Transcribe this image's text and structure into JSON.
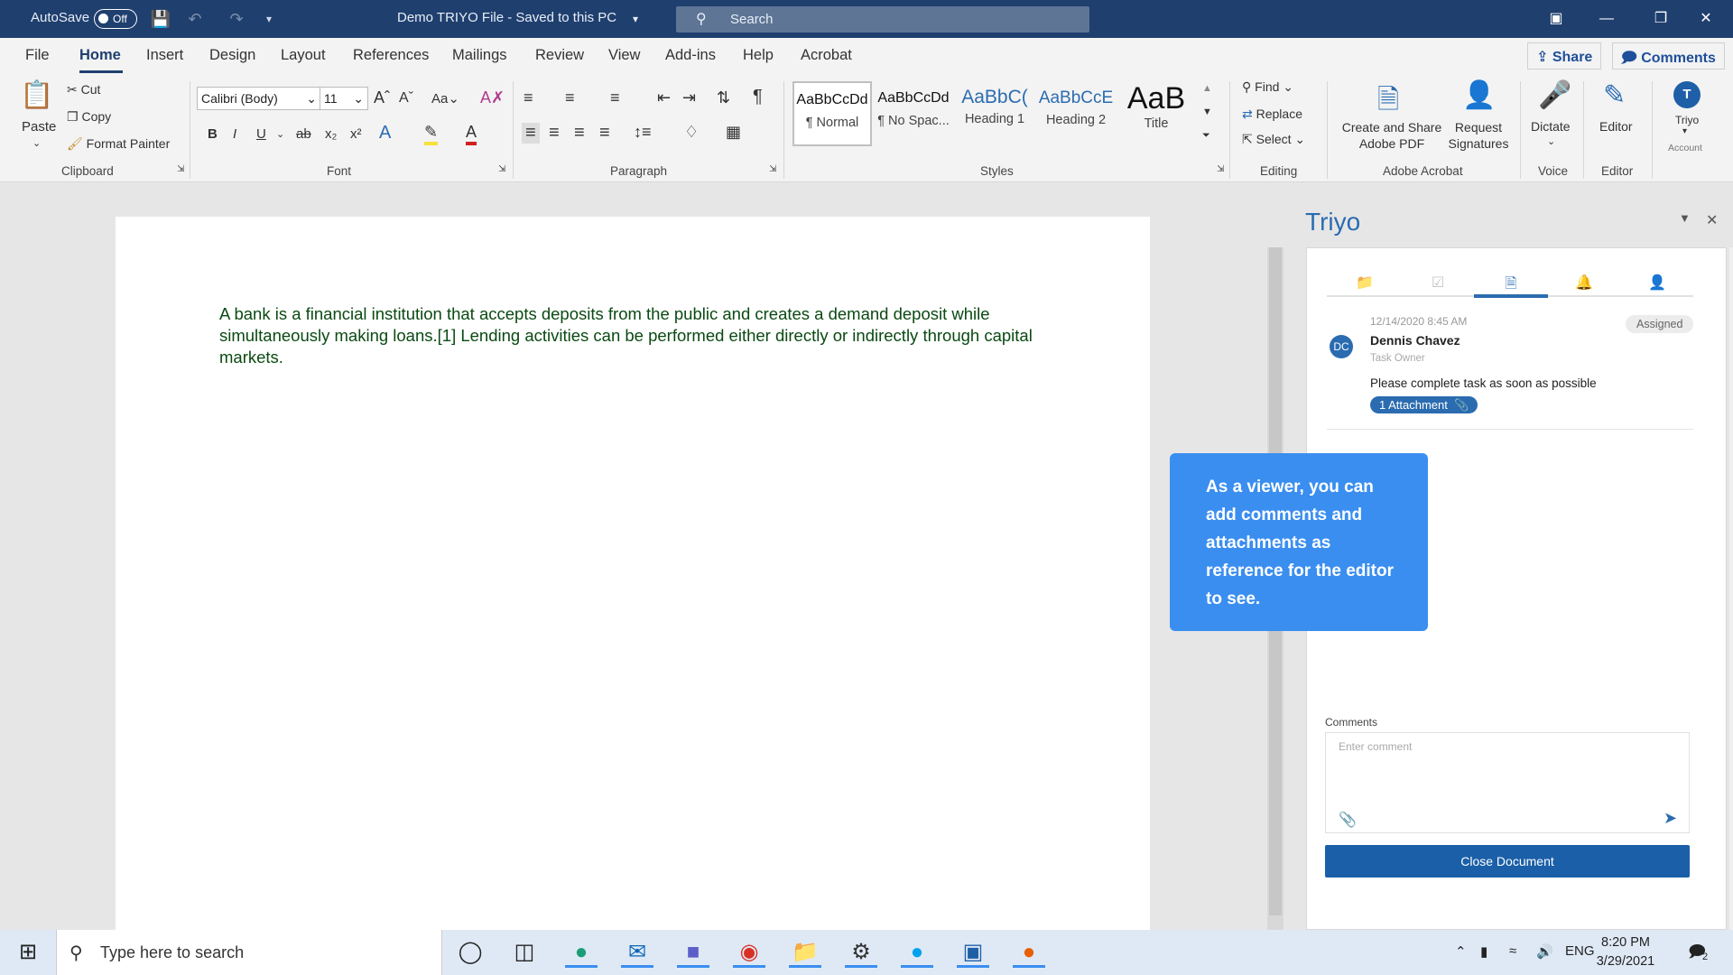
{
  "titlebar": {
    "autosave_label": "AutoSave",
    "autosave_state": "Off",
    "doc_title": "Demo TRIYO File  -  Saved to this PC",
    "search_placeholder": "Search"
  },
  "menu": {
    "tabs": [
      "File",
      "Home",
      "Insert",
      "Design",
      "Layout",
      "References",
      "Mailings",
      "Review",
      "View",
      "Add-ins",
      "Help",
      "Acrobat"
    ],
    "active_tab": "Home",
    "share": "Share",
    "comments": "Comments"
  },
  "ribbon": {
    "clipboard": {
      "paste": "Paste",
      "cut": "Cut",
      "copy": "Copy",
      "format_painter": "Format Painter",
      "label": "Clipboard"
    },
    "font": {
      "family": "Calibri (Body)",
      "size": "11",
      "label": "Font"
    },
    "paragraph": {
      "label": "Paragraph"
    },
    "styles": {
      "items": [
        {
          "preview": "AaBbCcDd",
          "name": "¶ Normal"
        },
        {
          "preview": "AaBbCcDd",
          "name": "¶ No Spac..."
        },
        {
          "preview": "AaBbC(",
          "name": "Heading 1"
        },
        {
          "preview": "AaBbCcE",
          "name": "Heading 2"
        },
        {
          "preview": "AaB",
          "name": "Title"
        }
      ],
      "label": "Styles"
    },
    "editing": {
      "find": "Find",
      "replace": "Replace",
      "select": "Select",
      "label": "Editing"
    },
    "acrobat": {
      "create": "Create and Share",
      "create2": "Adobe PDF",
      "request": "Request",
      "request2": "Signatures",
      "label": "Adobe Acrobat"
    },
    "voice": {
      "dictate": "Dictate",
      "label": "Voice"
    },
    "editor": {
      "editor": "Editor",
      "label": "Editor"
    },
    "account": {
      "triyo": "Triyo",
      "label": "Account",
      "initial": "T"
    }
  },
  "document": {
    "body": "A bank is a financial institution that accepts deposits from the public and creates a demand deposit while simultaneously making loans.[1] Lending activities can be performed either directly or indirectly through capital markets."
  },
  "pane": {
    "title": "Triyo",
    "timestamp": "12/14/2020  8:45 AM",
    "status": "Assigned",
    "avatar": "DC",
    "owner": "Dennis Chavez",
    "role": "Task Owner",
    "message": "Please complete task as soon as possible",
    "attachment": "1 Attachment",
    "comments_label": "Comments",
    "comment_placeholder": "Enter comment",
    "close_button": "Close Document"
  },
  "tooltip": {
    "text": "As a viewer, you can add comments and attachments as reference for the editor to see."
  },
  "taskbar": {
    "search_placeholder": "Type here to search",
    "lang": "ENG",
    "time": "8:20 PM",
    "date": "3/29/2021",
    "notifications": "2"
  },
  "colors": {
    "titlebar": "#1f3f6e",
    "accent": "#2b6cb0",
    "tooltip": "#3a8ef0",
    "doc_text": "#0a4a12"
  }
}
